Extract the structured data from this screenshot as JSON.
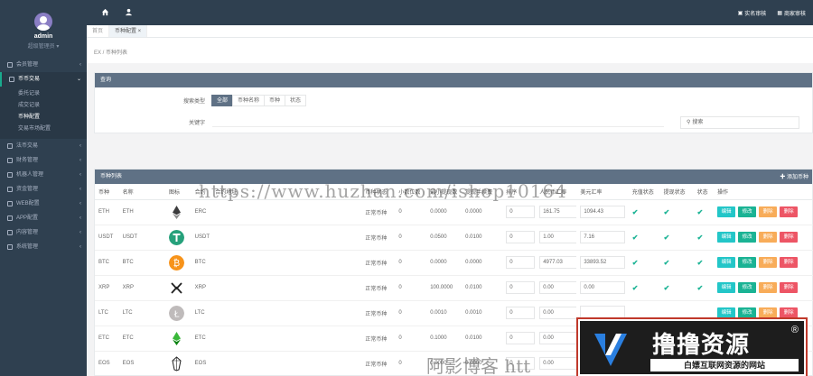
{
  "sidebar": {
    "user_name": "admin",
    "user_role": "超级管理员 ▾",
    "items": [
      {
        "label": "会员管理",
        "active": false
      },
      {
        "label": "币币交易",
        "active": true
      },
      {
        "label": "法币交易",
        "active": false
      },
      {
        "label": "财务管理",
        "active": false
      },
      {
        "label": "机器人管理",
        "active": false
      },
      {
        "label": "资金管理",
        "active": false
      },
      {
        "label": "WEB配置",
        "active": false
      },
      {
        "label": "APP配置",
        "active": false
      },
      {
        "label": "内容管理",
        "active": false
      },
      {
        "label": "系统管理",
        "active": false
      }
    ],
    "submenu": [
      "委托记录",
      "成交记录",
      "币种配置",
      "交易市场配置"
    ],
    "submenu_current": "币种配置"
  },
  "topbar": {
    "right_links": [
      "实名审核",
      "商家审核"
    ]
  },
  "tabs": [
    "首页",
    "币种配置 ×"
  ],
  "breadcrumb": "EX / 币种列表",
  "filter": {
    "title": "查询",
    "status_label": "搜索类型",
    "segments": [
      "全部",
      "币种名称",
      "币种",
      "状态"
    ],
    "keyword_label": "关键字",
    "keyword_value": "",
    "search_label": "搜索"
  },
  "table": {
    "title": "币种列表",
    "add_label": "✚ 添加币种",
    "headers": [
      "币种",
      "名称",
      "图标",
      "合约",
      "合约地址",
      "币种状态",
      "小数位数",
      "最小提现数",
      "提现手续费",
      "排序",
      "人民币汇率",
      "美元汇率",
      "充值状态",
      "提现状态",
      "状态",
      "操作"
    ],
    "ops": [
      "编辑",
      "修改",
      "删除",
      "删除"
    ],
    "rows": [
      {
        "coin": "ETH",
        "name": "ETH",
        "chain": "ERC",
        "addr": "",
        "status": "正常币种",
        "decimals": "0",
        "min": "0.0000",
        "fee": "0.0000",
        "sort": "0",
        "cny": "161.75",
        "usd": "1094.43",
        "c1": "✔",
        "c2": "✔",
        "c3": "✔",
        "icon": "eth"
      },
      {
        "coin": "USDT",
        "name": "USDT",
        "chain": "USDT",
        "addr": "",
        "status": "正常币种",
        "decimals": "0",
        "min": "0.0500",
        "fee": "0.0100",
        "sort": "0",
        "cny": "1.00",
        "usd": "7.16",
        "c1": "✔",
        "c2": "✔",
        "c3": "✔",
        "icon": "usdt"
      },
      {
        "coin": "BTC",
        "name": "BTC",
        "chain": "BTC",
        "addr": "",
        "status": "正常币种",
        "decimals": "0",
        "min": "0.0000",
        "fee": "0.0000",
        "sort": "0",
        "cny": "4977.03",
        "usd": "33893.52",
        "c1": "✔",
        "c2": "✔",
        "c3": "✔",
        "icon": "btc"
      },
      {
        "coin": "XRP",
        "name": "XRP",
        "chain": "XRP",
        "addr": "",
        "status": "正常币种",
        "decimals": "0",
        "min": "100.0000",
        "fee": "0.0100",
        "sort": "0",
        "cny": "0.00",
        "usd": "0.00",
        "c1": "✔",
        "c2": "✔",
        "c3": "✔",
        "icon": "xrp"
      },
      {
        "coin": "LTC",
        "name": "LTC",
        "chain": "LTC",
        "addr": "",
        "status": "正常币种",
        "decimals": "0",
        "min": "0.0010",
        "fee": "0.0010",
        "sort": "0",
        "cny": "0.00",
        "usd": "",
        "c1": "",
        "c2": "",
        "c3": "",
        "icon": "ltc"
      },
      {
        "coin": "ETC",
        "name": "ETC",
        "chain": "ETC",
        "addr": "",
        "status": "正常币种",
        "decimals": "0",
        "min": "0.1000",
        "fee": "0.0100",
        "sort": "0",
        "cny": "0.00",
        "usd": "",
        "c1": "",
        "c2": "",
        "c3": "",
        "icon": "etc"
      },
      {
        "coin": "EOS",
        "name": "EOS",
        "chain": "EOS",
        "addr": "",
        "status": "正常币种",
        "decimals": "0",
        "min": "0.0000",
        "fee": "0.0000",
        "sort": "0",
        "cny": "0.00",
        "usd": "",
        "c1": "",
        "c2": "",
        "c3": "",
        "icon": "eos"
      }
    ]
  },
  "watermarks": {
    "url": "https://www.huzhan.com/ishop10164",
    "bottom": "阿影博客 htt",
    "logo_title": "撸撸资源",
    "logo_sub": "白嫖互联网资源的网站",
    "logo_reg": "®"
  },
  "colors": {
    "sidebar_bg": "#2f4050",
    "panel_head": "#5f7185",
    "check": "#1ab394",
    "op_edit": "#23c6c8",
    "op_modify": "#1ab394",
    "op_warn": "#f8ac59",
    "op_delete": "#ed5565"
  }
}
